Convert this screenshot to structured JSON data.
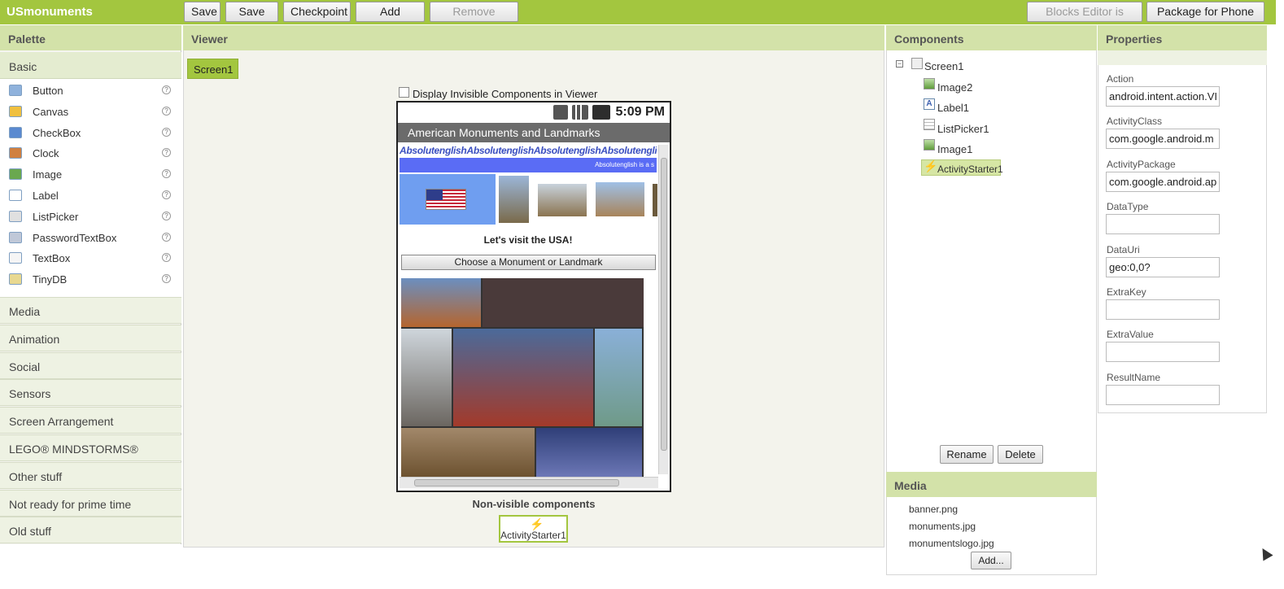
{
  "app": {
    "title": "USmonuments"
  },
  "toolbar": {
    "save": "Save",
    "save_as": "Save As",
    "checkpoint": "Checkpoint",
    "add_screen": "Add Screen",
    "remove_screen": "Remove Screen",
    "blocks_editor": "Blocks Editor is open",
    "package": "Package for Phone ▾"
  },
  "palette": {
    "title": "Palette",
    "basic": "Basic",
    "items": [
      {
        "label": "Button",
        "icon": "button-icon"
      },
      {
        "label": "Canvas",
        "icon": "canvas-icon"
      },
      {
        "label": "CheckBox",
        "icon": "checkbox-icon"
      },
      {
        "label": "Clock",
        "icon": "clock-icon"
      },
      {
        "label": "Image",
        "icon": "image-icon"
      },
      {
        "label": "Label",
        "icon": "label-icon"
      },
      {
        "label": "ListPicker",
        "icon": "listpicker-icon"
      },
      {
        "label": "PasswordTextBox",
        "icon": "password-icon"
      },
      {
        "label": "TextBox",
        "icon": "textbox-icon"
      },
      {
        "label": "TinyDB",
        "icon": "database-icon"
      }
    ],
    "help": "?",
    "categories": [
      "Media",
      "Animation",
      "Social",
      "Sensors",
      "Screen Arrangement",
      "LEGO® MINDSTORMS®",
      "Other stuff",
      "Not ready for prime time",
      "Old stuff"
    ]
  },
  "viewer": {
    "title": "Viewer",
    "screen_tab": "Screen1",
    "invisible_label": "Display Invisible Components in Viewer",
    "phone": {
      "time": "5:09 PM",
      "app_title": "American Monuments and Landmarks",
      "banner": "AbsolutenglishAbsolutenglishAbsolutenglishAbsolutenglish",
      "banner_sub": "Absolutenglish is a s",
      "visit": "Let's visit the USA!",
      "choose_button": "Choose a Monument or Landmark"
    },
    "nonvisible_title": "Non-visible components",
    "nonvisible_item": "ActivityStarter1"
  },
  "components": {
    "title": "Components",
    "tree": [
      "Screen1",
      "Image2",
      "Label1",
      "ListPicker1",
      "Image1",
      "ActivityStarter1"
    ],
    "rename": "Rename",
    "delete": "Delete"
  },
  "media": {
    "title": "Media",
    "files": [
      "banner.png",
      "monuments.jpg",
      "monumentslogo.jpg"
    ],
    "add": "Add..."
  },
  "properties": {
    "title": "Properties",
    "fields": [
      {
        "label": "Action",
        "value": "android.intent.action.VI"
      },
      {
        "label": "ActivityClass",
        "value": "com.google.android.m"
      },
      {
        "label": "ActivityPackage",
        "value": "com.google.android.ap"
      },
      {
        "label": "DataType",
        "value": ""
      },
      {
        "label": "DataUri",
        "value": "geo:0,0?"
      },
      {
        "label": "ExtraKey",
        "value": ""
      },
      {
        "label": "ExtraValue",
        "value": ""
      },
      {
        "label": "ResultName",
        "value": ""
      }
    ]
  }
}
